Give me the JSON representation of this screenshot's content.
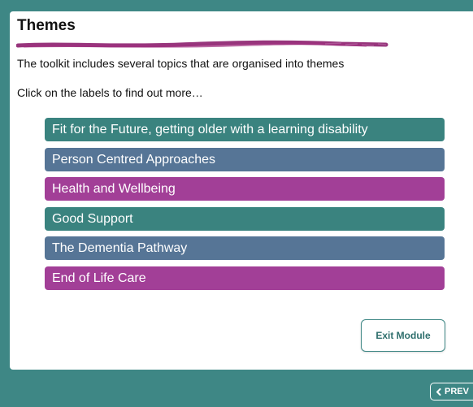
{
  "page": {
    "title": "Themes",
    "intro": "The toolkit includes several topics that are organised into themes",
    "instruction": "Click on the labels to find out more…"
  },
  "topics": [
    {
      "label": "Fit for the Future, getting older with a learning disability",
      "color": "#3a837f"
    },
    {
      "label": "Person Centred Approaches",
      "color": "#567596"
    },
    {
      "label": "Health and Wellbeing",
      "color": "#a23f97"
    },
    {
      "label": "Good Support",
      "color": "#3a837f"
    },
    {
      "label": "The Dementia Pathway",
      "color": "#567596"
    },
    {
      "label": "End of Life Care",
      "color": "#a23f97"
    }
  ],
  "buttons": {
    "exit_label": "Exit Module",
    "prev_label": "PREV",
    "prev_icon": "chevron-left-icon"
  },
  "colors": {
    "background": "#3e8785",
    "brush_stroke": "#8c1f6e"
  }
}
